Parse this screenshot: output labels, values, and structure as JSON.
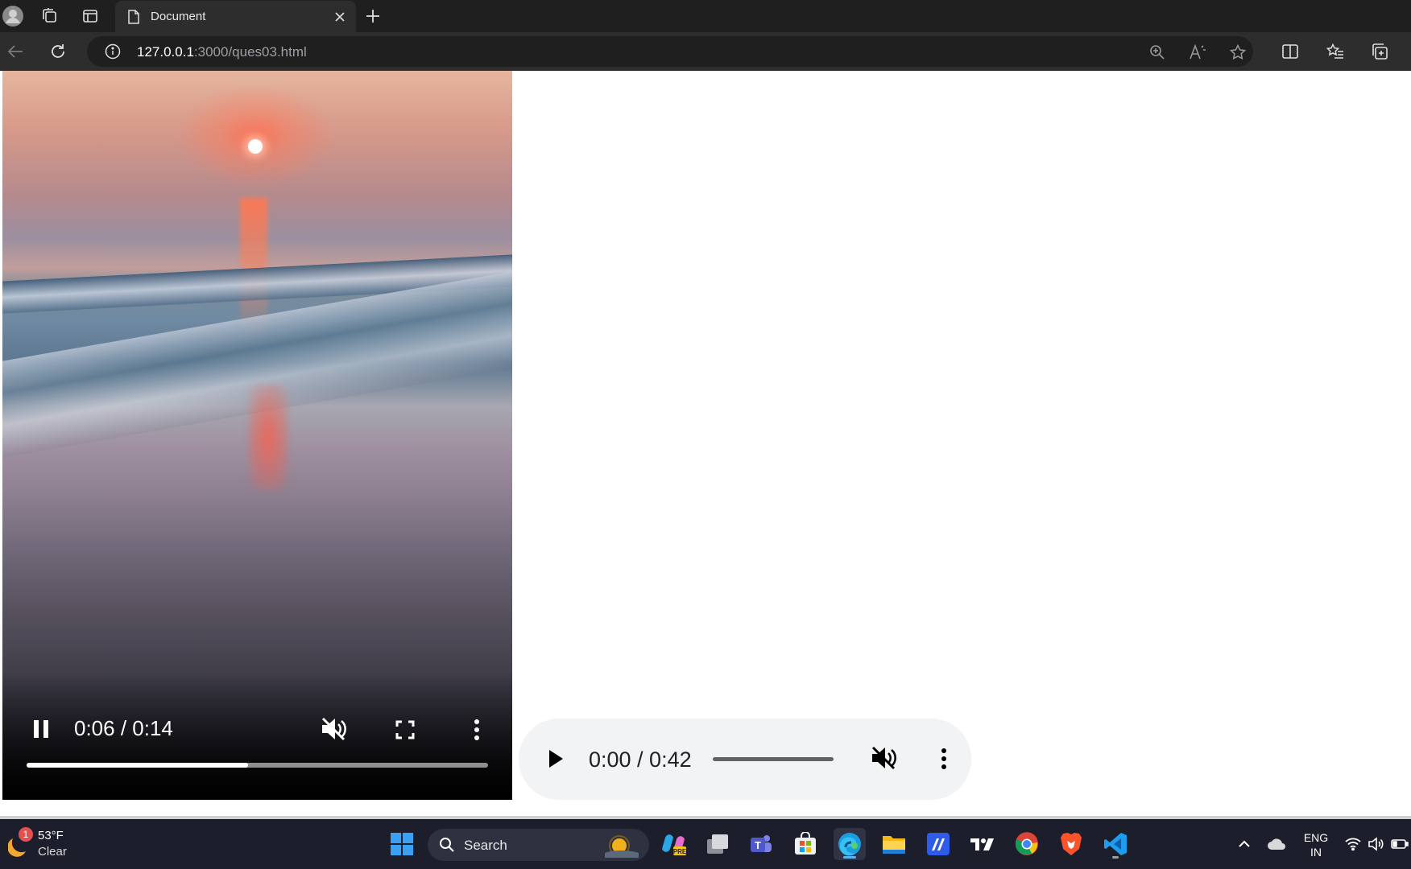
{
  "browser": {
    "tab": {
      "title": "Document"
    },
    "address": {
      "host": "127.0.0.1",
      "rest": ":3000/ques03.html"
    }
  },
  "video": {
    "current_time": "0:06",
    "duration": "0:14",
    "time_label": "0:06 / 0:14",
    "progress_fraction": 0.48,
    "playing": true,
    "muted": true
  },
  "audio": {
    "time_label": "0:00 / 0:42",
    "playing": false,
    "muted": true
  },
  "taskbar": {
    "weather": {
      "temp": "53°F",
      "condition": "Clear",
      "badge": "1"
    },
    "search_label": "Search",
    "apps": [
      "copilot-pre",
      "task-view",
      "teams",
      "microsoft-store",
      "edge",
      "file-explorer",
      "app-blue",
      "tradingview",
      "chrome",
      "brave",
      "vscode"
    ],
    "lang": {
      "line1": "ENG",
      "line2": "IN"
    }
  },
  "colors": {
    "tabstrip": "#1f1f1f",
    "toolbar": "#2d2d2d",
    "audio_bg": "#f1f3f4",
    "taskbar": "#1c1f2b",
    "edge_active_indicator": "#5fb2f2"
  }
}
